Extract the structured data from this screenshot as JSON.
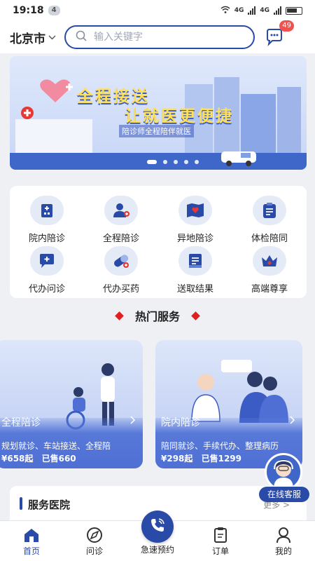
{
  "status_bar": {
    "time": "19:18",
    "notification_count": "4",
    "net1": "4G",
    "net2": "4G"
  },
  "header": {
    "city": "北京市",
    "search_placeholder": "输入关键字",
    "message_badge": "49"
  },
  "banner": {
    "title_line1": "全程接送",
    "title_line2": "让就医更便捷",
    "subtitle": "陪诊师全程陪伴就医",
    "slide_count": 5,
    "active_slide": 0
  },
  "services_grid": [
    {
      "label": "院内陪诊",
      "icon": "hospital-icon"
    },
    {
      "label": "全程陪诊",
      "icon": "companion-icon"
    },
    {
      "label": "异地陪诊",
      "icon": "map-heart-icon"
    },
    {
      "label": "体检陪同",
      "icon": "checkup-icon"
    },
    {
      "label": "代办问诊",
      "icon": "chat-plus-icon"
    },
    {
      "label": "代办买药",
      "icon": "pill-icon"
    },
    {
      "label": "送取结果",
      "icon": "report-icon"
    },
    {
      "label": "高端尊享",
      "icon": "crown-icon"
    }
  ],
  "hot_services": {
    "title": "热门服务",
    "cards": [
      {
        "name": "全程陪诊",
        "desc": "规划就诊、车站接送、全程陪",
        "price": "¥658起",
        "sold": "已售660"
      },
      {
        "name": "院内陪诊",
        "desc": "陪同就诊、手续代办、整理病历",
        "price": "¥298起",
        "sold": "已售1299"
      }
    ]
  },
  "hospital_section": {
    "title": "服务医院",
    "more": "更多 >"
  },
  "floating_service": {
    "label": "在线客服"
  },
  "tabbar": {
    "home": "首页",
    "consult": "问诊",
    "urgent": "急速预约",
    "orders": "订单",
    "mine": "我的"
  },
  "colors": {
    "primary": "#2a4aa8",
    "banner_text": "#ffe05a",
    "badge": "#ef5350",
    "diamond": "#e02020"
  }
}
